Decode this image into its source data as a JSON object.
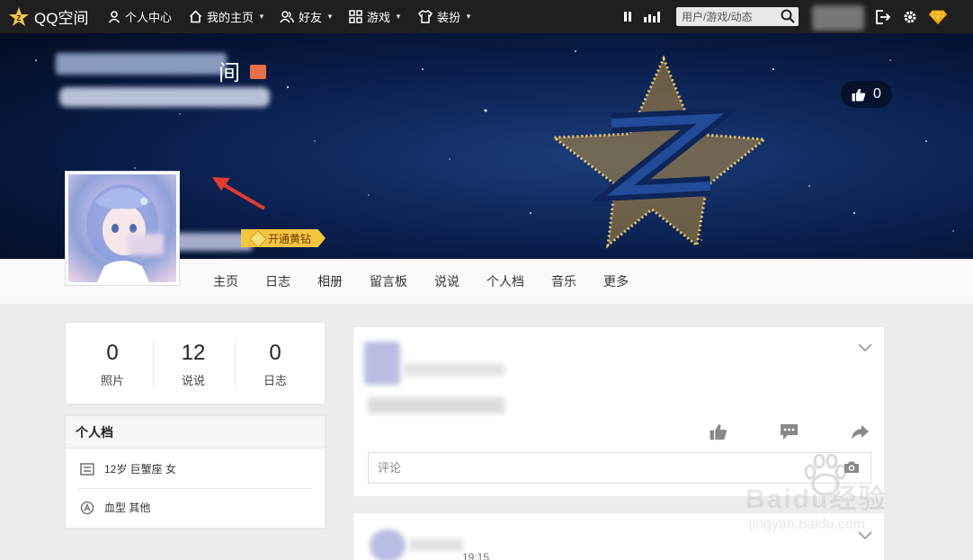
{
  "topbar": {
    "brand": "QQ空间",
    "personal_center": "个人中心",
    "my_home": "我的主页",
    "friends": "好友",
    "games": "游戏",
    "dress_up": "装扮",
    "search_placeholder": "用户/游戏/动态"
  },
  "banner": {
    "title_fragment": "间",
    "like_count": "0",
    "open_vip_label": "开通黄钻"
  },
  "nav": {
    "items": [
      "主页",
      "日志",
      "相册",
      "留言板",
      "说说",
      "个人档",
      "音乐",
      "更多"
    ]
  },
  "stats": [
    {
      "value": "0",
      "label": "照片"
    },
    {
      "value": "12",
      "label": "说说"
    },
    {
      "value": "0",
      "label": "日志"
    }
  ],
  "profile": {
    "title": "个人档",
    "age_info": "12岁  巨蟹座 女",
    "blood_info": "血型 其他"
  },
  "feed": {
    "comment_placeholder": "评论",
    "second_post_time": "19:15"
  },
  "watermark": {
    "brand": "Baidu经验",
    "url": "jingyan.baidu.com"
  },
  "colors": {
    "topbar_bg": "#1f1f1f",
    "vip_yellow": "#f5c542",
    "banner_blue": "#0d2558"
  }
}
